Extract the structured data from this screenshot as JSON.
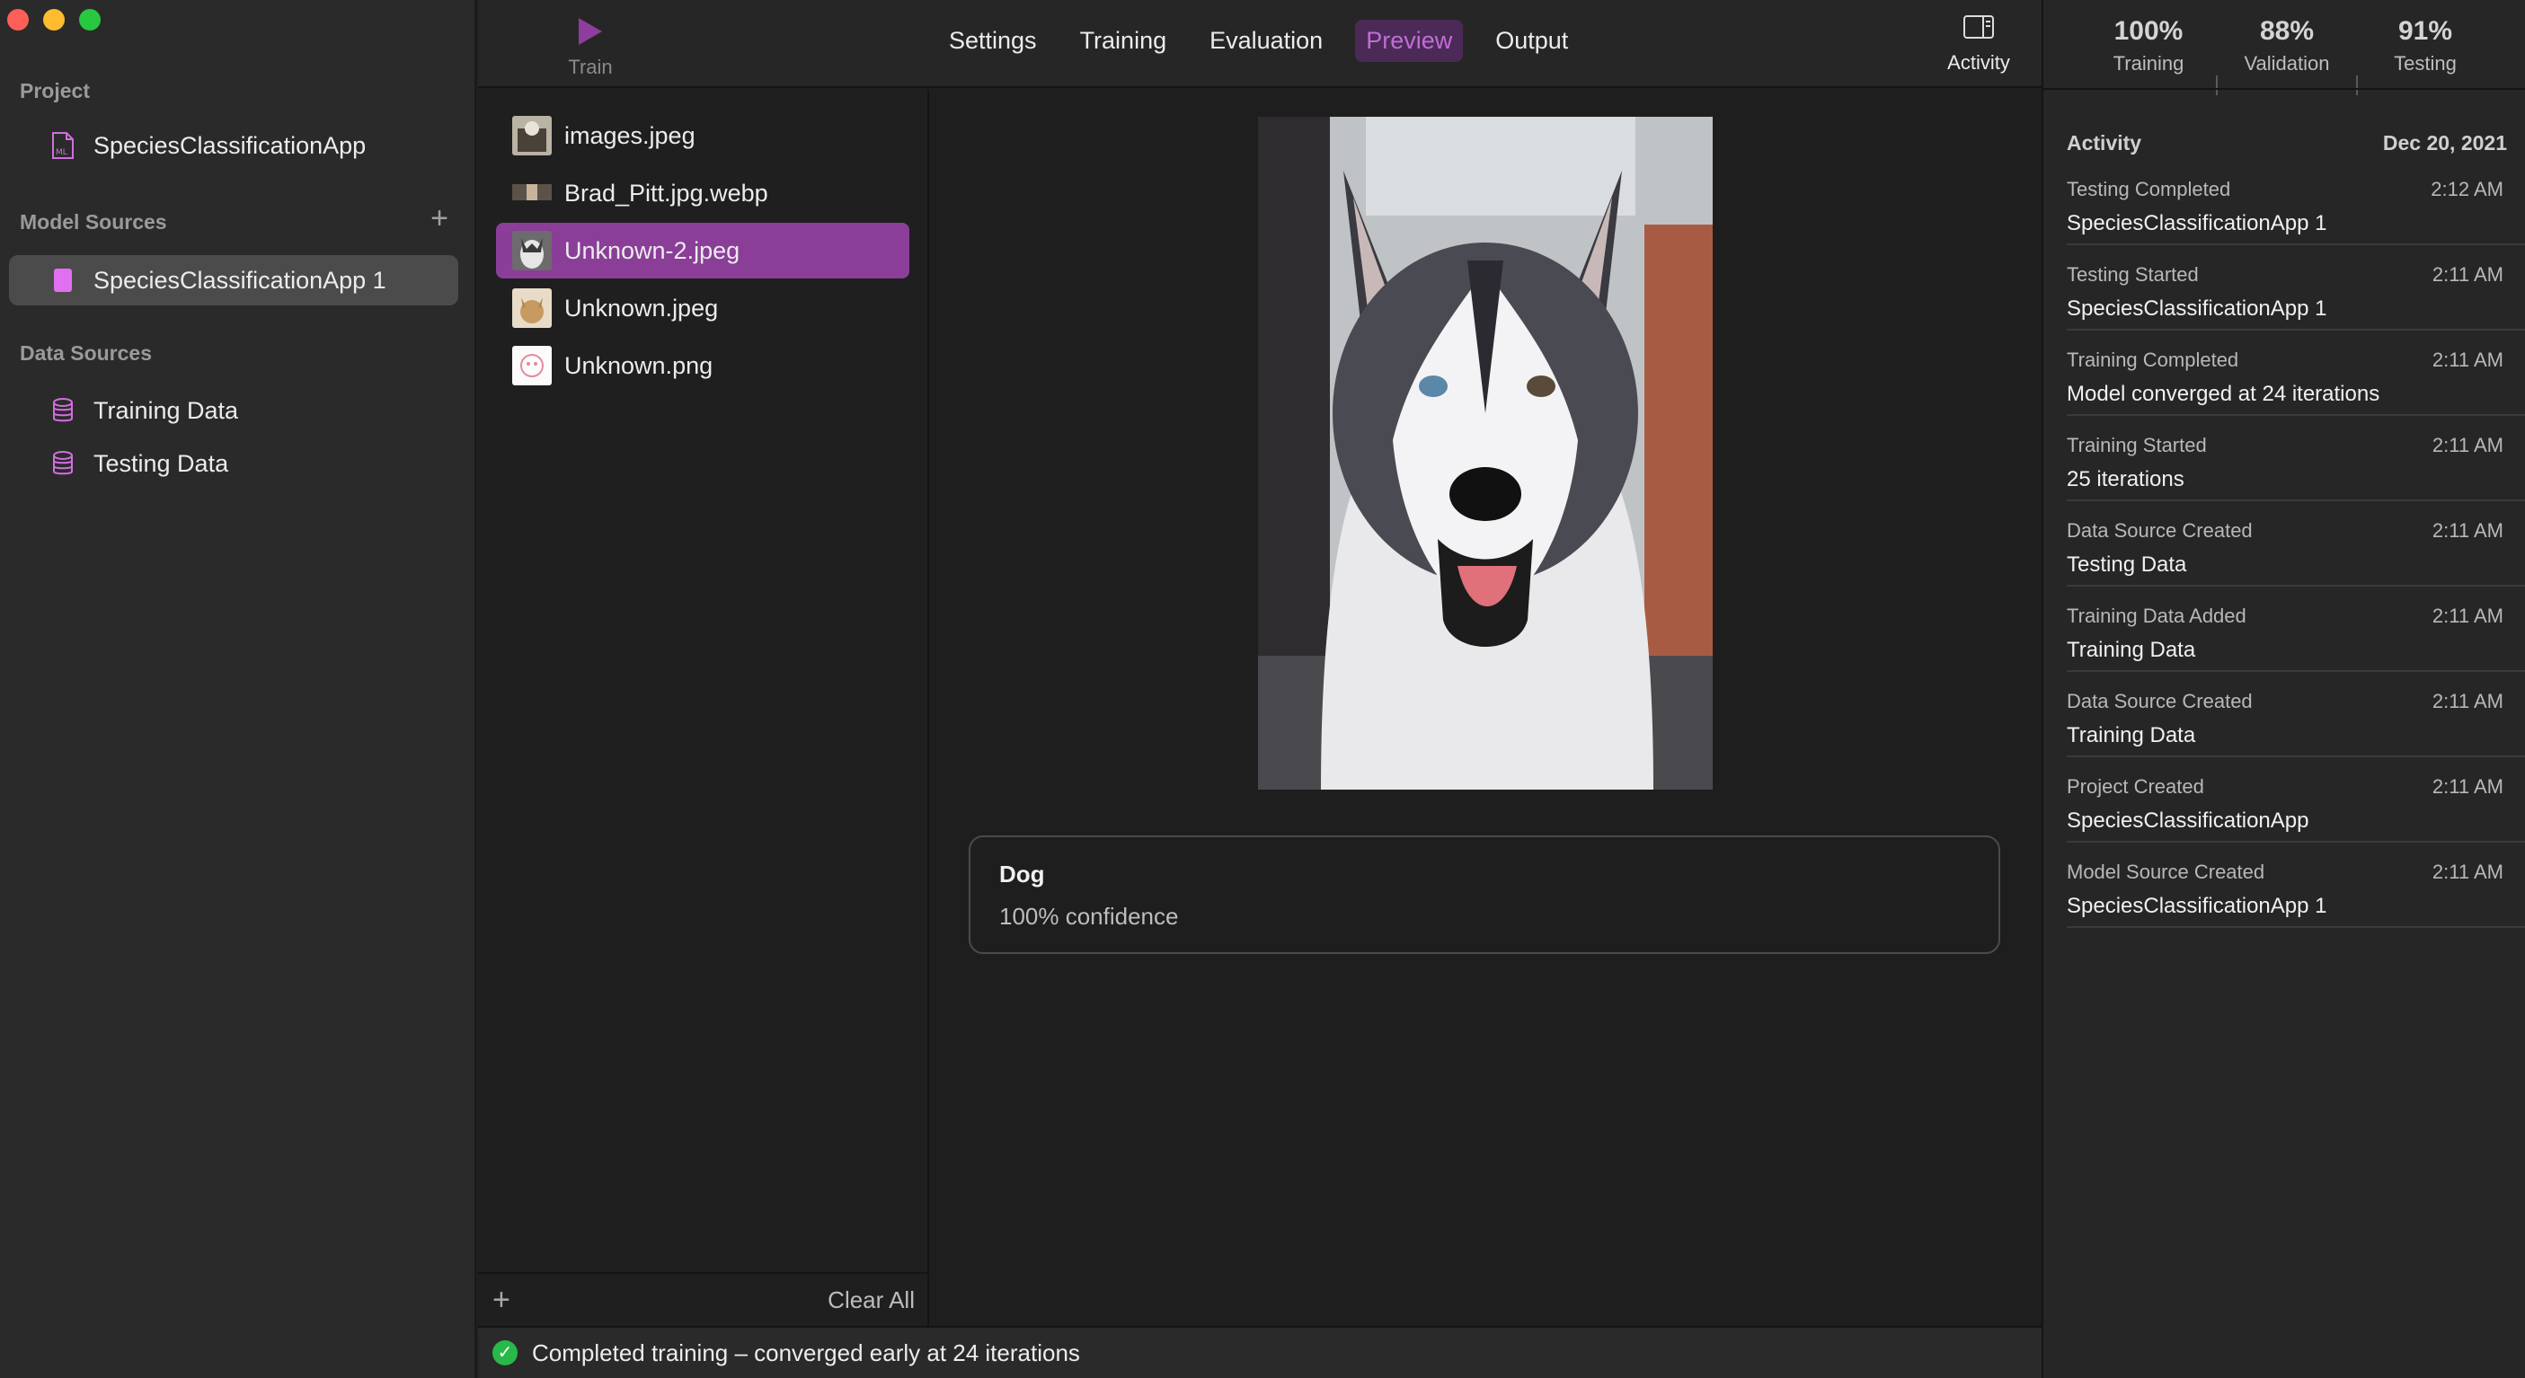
{
  "window": {
    "traffic_lights": [
      "close",
      "minimize",
      "zoom"
    ]
  },
  "sidebar": {
    "project_section": "Project",
    "project_item": "SpeciesClassificationApp",
    "model_sources_section": "Model Sources",
    "model_source_item": "SpeciesClassificationApp 1",
    "data_sources_section": "Data Sources",
    "data_items": [
      "Training Data",
      "Testing Data"
    ]
  },
  "toolbar": {
    "train_label": "Train",
    "tabs": [
      "Settings",
      "Training",
      "Evaluation",
      "Preview",
      "Output"
    ],
    "active_tab": "Preview",
    "activity_label": "Activity"
  },
  "stats": [
    {
      "value": "100%",
      "caption": "Training"
    },
    {
      "value": "88%",
      "caption": "Validation"
    },
    {
      "value": "91%",
      "caption": "Testing"
    }
  ],
  "activity": {
    "title": "Activity",
    "date": "Dec 20, 2021",
    "items": [
      {
        "event": "Testing Completed",
        "time": "2:12 AM",
        "detail": "SpeciesClassificationApp 1"
      },
      {
        "event": "Testing Started",
        "time": "2:11 AM",
        "detail": "SpeciesClassificationApp 1"
      },
      {
        "event": "Training Completed",
        "time": "2:11 AM",
        "detail": "Model converged at 24 iterations"
      },
      {
        "event": "Training Started",
        "time": "2:11 AM",
        "detail": "25 iterations"
      },
      {
        "event": "Data Source Created",
        "time": "2:11 AM",
        "detail": "Testing Data"
      },
      {
        "event": "Training Data Added",
        "time": "2:11 AM",
        "detail": "Training Data"
      },
      {
        "event": "Data Source Created",
        "time": "2:11 AM",
        "detail": "Training Data"
      },
      {
        "event": "Project Created",
        "time": "2:11 AM",
        "detail": "SpeciesClassificationApp"
      },
      {
        "event": "Model Source Created",
        "time": "2:11 AM",
        "detail": "SpeciesClassificationApp 1"
      }
    ]
  },
  "files": {
    "items": [
      "images.jpeg",
      "Brad_Pitt.jpg.webp",
      "Unknown-2.jpeg",
      "Unknown.jpeg",
      "Unknown.png"
    ],
    "selected": "Unknown-2.jpeg",
    "clear_label": "Clear All"
  },
  "prediction": {
    "label": "Dog",
    "confidence": "100% confidence"
  },
  "status": {
    "message": "Completed training – converged early at 24 iterations"
  },
  "colors": {
    "accent": "#8a3e98",
    "accent_text": "#c06ed4",
    "success": "#29b84a"
  }
}
